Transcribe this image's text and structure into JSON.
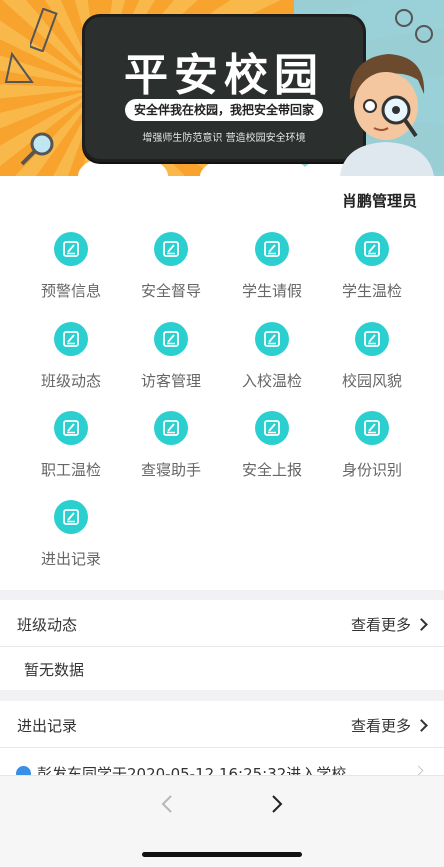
{
  "banner": {
    "title": "平安校园",
    "slogan": "安全伴我在校园，我把安全带回家",
    "subtitle": "增强师生防范意识 营造校园安全环境"
  },
  "header": {
    "admin_name": "肖鹏管理员"
  },
  "grid": {
    "items": [
      {
        "label": "预警信息",
        "icon": "edit-icon"
      },
      {
        "label": "安全督导",
        "icon": "edit-icon"
      },
      {
        "label": "学生请假",
        "icon": "edit-icon"
      },
      {
        "label": "学生温检",
        "icon": "edit-icon"
      },
      {
        "label": "班级动态",
        "icon": "edit-icon"
      },
      {
        "label": "访客管理",
        "icon": "edit-icon"
      },
      {
        "label": "入校温检",
        "icon": "edit-icon"
      },
      {
        "label": "校园风貌",
        "icon": "edit-icon"
      },
      {
        "label": "职工温检",
        "icon": "edit-icon"
      },
      {
        "label": "查寝助手",
        "icon": "edit-icon"
      },
      {
        "label": "安全上报",
        "icon": "edit-icon"
      },
      {
        "label": "身份识别",
        "icon": "edit-icon"
      },
      {
        "label": "进出记录",
        "icon": "edit-icon"
      }
    ]
  },
  "class_news": {
    "title": "班级动态",
    "more_label": "查看更多",
    "empty_text": "暂无数据"
  },
  "entry_records": {
    "title": "进出记录",
    "more_label": "查看更多",
    "records": [
      {
        "text": "彭发东同学于2020-05-12 16:25:32进入学校",
        "icon": "user-icon"
      }
    ]
  },
  "colors": {
    "accent": "#2ccfd0",
    "banner_orange": "#f7a32e",
    "board_dark": "#2b2f2d",
    "record_icon": "#3a8ee6"
  },
  "browser": {
    "back_icon": "chevron-left-icon",
    "forward_icon": "chevron-right-icon"
  }
}
